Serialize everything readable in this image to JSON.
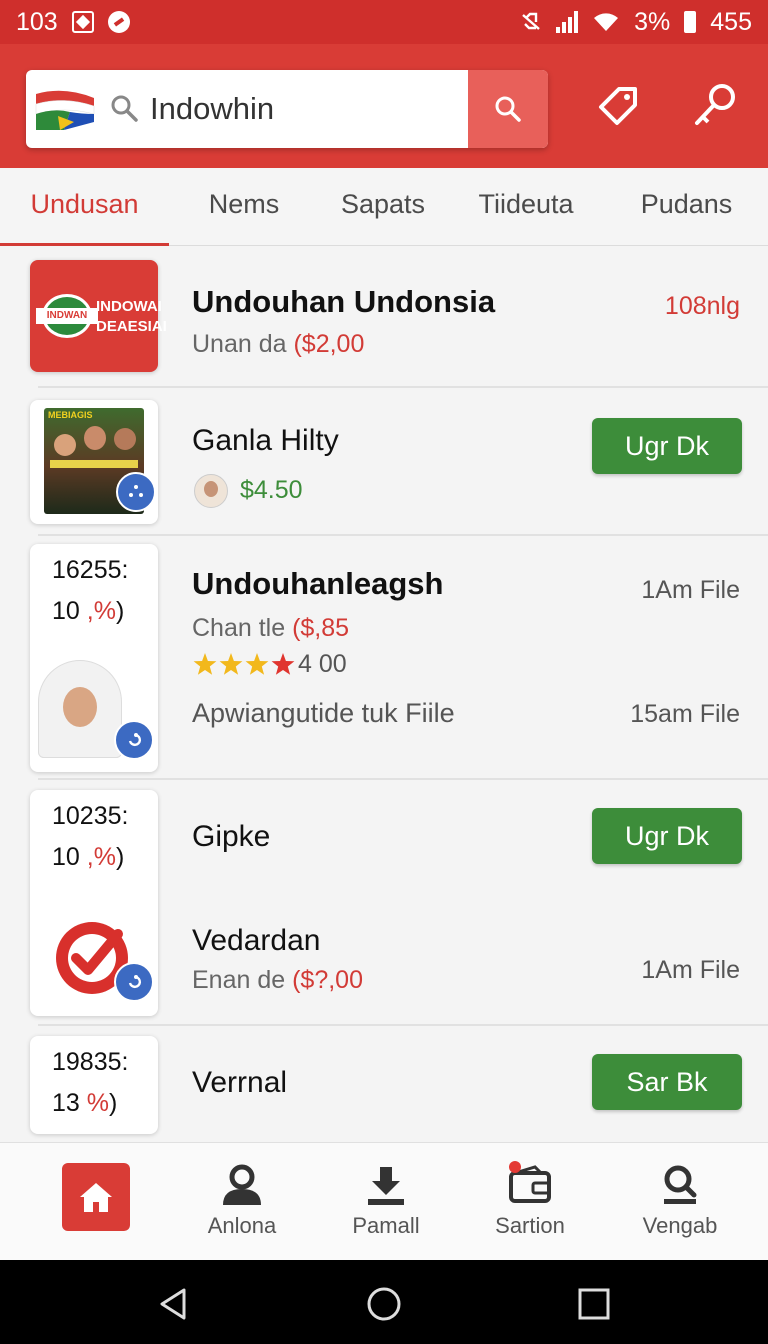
{
  "status_bar": {
    "time": "103",
    "right_text": "3%",
    "clock_right": "455"
  },
  "header": {
    "search_value": "Indowhin",
    "logo_icon": "flag-logo",
    "icons": [
      "tag-icon",
      "key-icon"
    ]
  },
  "tabs": [
    {
      "label": "Undusan",
      "active": true
    },
    {
      "label": "Nems"
    },
    {
      "label": "Sapats"
    },
    {
      "label": "Tiideuta"
    },
    {
      "label": "Pudans"
    }
  ],
  "items": [
    {
      "logo_line1": "INDOWAI",
      "logo_line2": "DEAESIAI",
      "logo_seal": "INDWAN",
      "title": "Undouhan Undonsia",
      "sub_prefix": "Unan da ",
      "sub_price": "($2,00",
      "right": "108nlg"
    },
    {
      "poster_text": "MEBIAGIS",
      "title": "Ganla Hilty",
      "price": "$4.50",
      "button": "Ugr Dk"
    },
    {
      "stat_line1": "16255:",
      "stat_num": "10 ",
      "stat_pct": ",%",
      "stat_close": ")",
      "title": "Undouhanleagsh",
      "sub_prefix": "Chan tle ",
      "sub_price": "($,85",
      "rating_text": "4 00",
      "rating": 4,
      "desc": "Apwiangutide tuk Fiile",
      "right_top": "1Am File",
      "right_bottom": "15am File"
    },
    {
      "stat_line1": "10235:",
      "stat_num": "10 ",
      "stat_pct": ",%",
      "stat_close": ")",
      "title": "Gipke",
      "button": "Ugr Dk",
      "title2": "Vedardan",
      "sub_prefix": "Enan de ",
      "sub_price": "($?,00",
      "right": "1Am File"
    },
    {
      "stat_line1": "19835:",
      "stat_num": "13 ",
      "stat_pct": "%",
      "stat_close": ")",
      "title": "Verrnal",
      "button": "Sar Bk"
    }
  ],
  "bottom_nav": [
    {
      "label": "",
      "icon": "home-icon",
      "active": true
    },
    {
      "label": "Anlona",
      "icon": "user-icon"
    },
    {
      "label": "Pamall",
      "icon": "download-icon"
    },
    {
      "label": "Sartion",
      "icon": "wallet-icon"
    },
    {
      "label": "Vengab",
      "icon": "search-person-icon"
    }
  ],
  "colors": {
    "brand_red": "#d93c36",
    "accent_green": "#3d8d3a",
    "badge_blue": "#3c6ac2"
  }
}
